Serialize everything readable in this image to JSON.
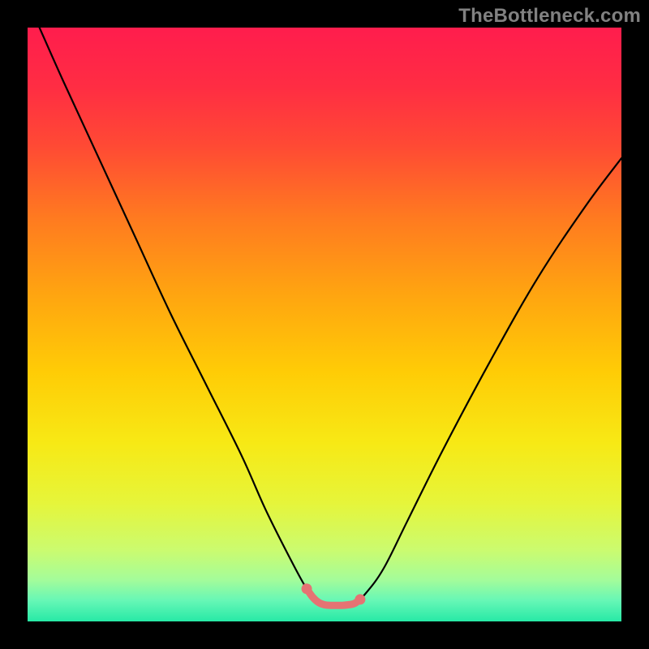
{
  "attribution": "TheBottleneck.com",
  "colors": {
    "frame": "#000000",
    "curve": "#000000",
    "marker": "#e57373",
    "gradient_stops": [
      {
        "offset": 0.0,
        "color": "#ff1d4d"
      },
      {
        "offset": 0.1,
        "color": "#ff2d43"
      },
      {
        "offset": 0.2,
        "color": "#ff4a34"
      },
      {
        "offset": 0.32,
        "color": "#ff7a20"
      },
      {
        "offset": 0.45,
        "color": "#ffa510"
      },
      {
        "offset": 0.58,
        "color": "#ffcc06"
      },
      {
        "offset": 0.7,
        "color": "#f7e915"
      },
      {
        "offset": 0.8,
        "color": "#e6f53a"
      },
      {
        "offset": 0.88,
        "color": "#cbfb6f"
      },
      {
        "offset": 0.93,
        "color": "#a4fc9a"
      },
      {
        "offset": 0.965,
        "color": "#66f7b6"
      },
      {
        "offset": 1.0,
        "color": "#27e9a6"
      }
    ]
  },
  "chart_data": {
    "type": "line",
    "title": "",
    "xlabel": "",
    "ylabel": "",
    "xlim": [
      0,
      100
    ],
    "ylim": [
      0,
      100
    ],
    "series": [
      {
        "name": "bottleneck-curve",
        "x": [
          2,
          6,
          12,
          18,
          24,
          30,
          36,
          40,
          44,
          47,
          49,
          51,
          53,
          55,
          57,
          60,
          64,
          70,
          78,
          86,
          94,
          100
        ],
        "y": [
          100,
          91,
          78,
          65,
          52,
          40,
          28,
          19,
          11,
          5.5,
          3.2,
          2.7,
          2.7,
          3.0,
          4.8,
          9,
          17,
          29,
          44,
          58,
          70,
          78
        ]
      }
    ],
    "markers": {
      "name": "highlight-band",
      "x": [
        47.0,
        48.0,
        49.0,
        50.0,
        51.0,
        52.0,
        53.0,
        54.0,
        55.0,
        56.0
      ],
      "y": [
        5.5,
        4.1,
        3.2,
        2.8,
        2.7,
        2.7,
        2.7,
        2.8,
        3.0,
        3.7
      ]
    }
  }
}
